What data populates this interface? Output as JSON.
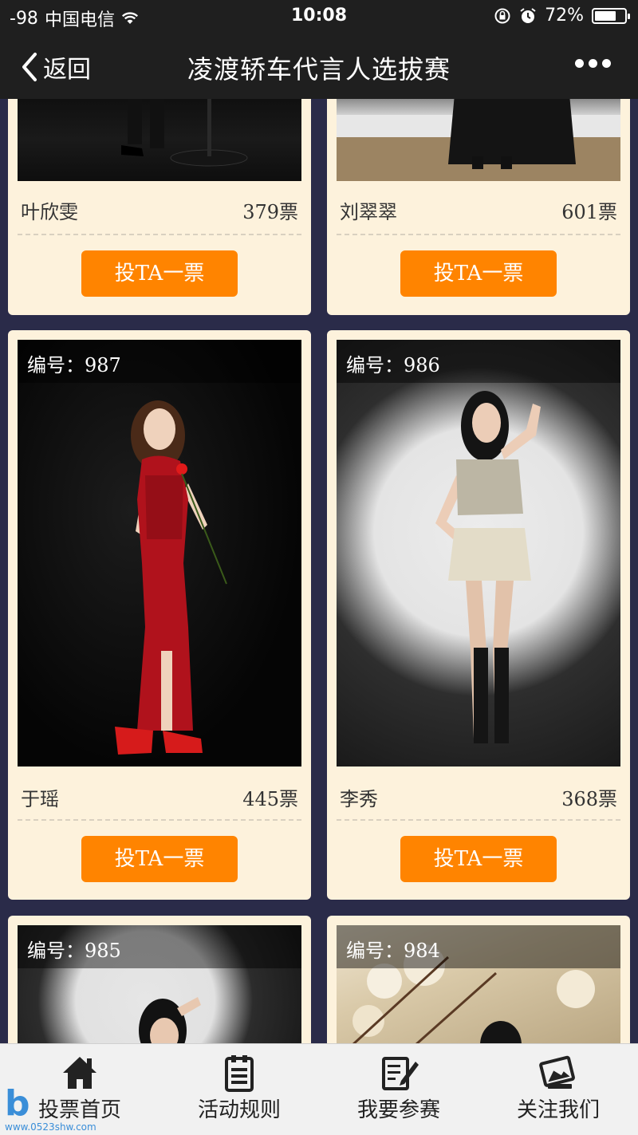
{
  "status_bar": {
    "signal": "-98",
    "carrier": "中国电信",
    "time": "10:08",
    "battery": "72%",
    "battery_level": 0.72
  },
  "nav": {
    "back_label": "返回",
    "title": "凌渡轿车代言人选拔赛"
  },
  "vote_button_label": "投TA一票",
  "contestants": [
    {
      "name": "叶欣雯",
      "votes": "379票"
    },
    {
      "name": "刘翠翠",
      "votes": "601票"
    },
    {
      "number_label": "编号：987",
      "name": "于瑶",
      "votes": "445票"
    },
    {
      "number_label": "编号：986",
      "name": "李秀",
      "votes": "368票"
    },
    {
      "number_label": "编号：985"
    },
    {
      "number_label": "编号：984"
    }
  ],
  "tabs": [
    {
      "label": "投票首页",
      "icon": "home-icon"
    },
    {
      "label": "活动规则",
      "icon": "rules-clipboard-icon"
    },
    {
      "label": "我要参赛",
      "icon": "signup-edit-icon"
    },
    {
      "label": "关注我们",
      "icon": "follow-card-icon"
    }
  ],
  "watermark": {
    "text": "www.0523shw.com"
  },
  "colors": {
    "page_bg": "#2a2b49",
    "card_bg": "#fdf2dc",
    "vote_button": "#ff8400",
    "topbar": "#1f1f1f"
  }
}
